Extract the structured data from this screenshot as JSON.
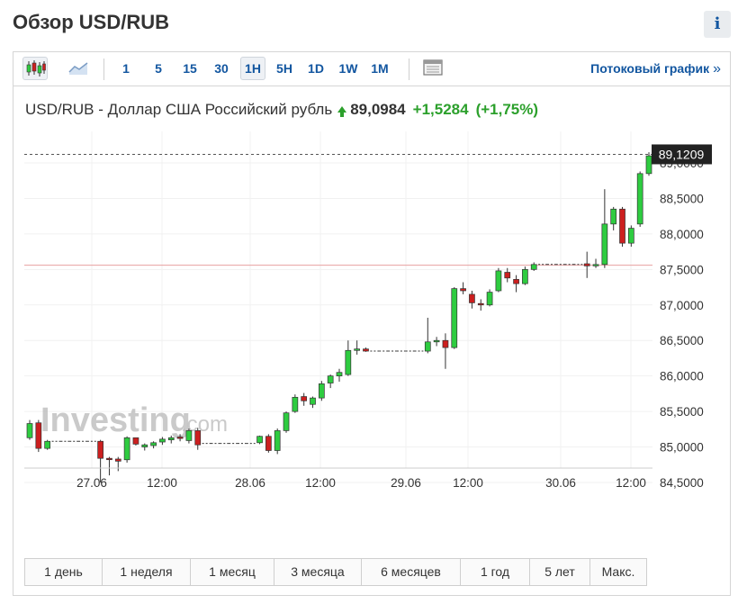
{
  "header": {
    "title": "Обзор USD/RUB",
    "info_label": "i"
  },
  "toolbar": {
    "chart_type_icons": [
      "candlestick-icon",
      "area-chart-icon"
    ],
    "intervals": [
      "1",
      "5",
      "15",
      "30",
      "1H",
      "5H",
      "1D",
      "1W",
      "1M"
    ],
    "active_interval": "1H",
    "table_icon": "table-icon",
    "stream_link": "Потоковый график",
    "stream_chevron": "»"
  },
  "quote": {
    "name": "USD/RUB - Доллар США Российский рубль",
    "price": "89,0984",
    "change": "+1,5284",
    "change_pct": "(+1,75%)"
  },
  "watermark": {
    "brand": "Investing",
    "suffix": ".com"
  },
  "colors": {
    "up": "#2ecc40",
    "down": "#cc1f1f",
    "accent": "#1256a0",
    "change": "#2ca02c",
    "label_bg": "#222222"
  },
  "chart_data": {
    "type": "candlestick",
    "ylim": [
      84.35,
      89.35
    ],
    "y_ticks": [
      "84,5000",
      "85,0000",
      "85,5000",
      "86,0000",
      "86,5000",
      "87,0000",
      "87,5000",
      "88,0000",
      "88,5000",
      "89,0000"
    ],
    "x_ticks": [
      "27.06",
      "12:00",
      "28.06",
      "12:00",
      "29.06",
      "12:00",
      "30.06",
      "12:00"
    ],
    "last_price_label": "89,1209",
    "last_price": 89.1209,
    "reference_line": 87.56,
    "candles": [
      {
        "o": 85.13,
        "h": 85.38,
        "l": 85.1,
        "c": 85.33
      },
      {
        "o": 85.34,
        "h": 85.38,
        "l": 84.93,
        "c": 84.98
      },
      {
        "o": 84.98,
        "h": 85.1,
        "l": 84.96,
        "c": 85.08
      },
      {
        "o": 85.08,
        "h": 85.08,
        "l": 85.08,
        "c": 85.08
      },
      {
        "o": 85.08,
        "h": 85.08,
        "l": 85.08,
        "c": 85.08
      },
      {
        "o": 85.08,
        "h": 85.08,
        "l": 85.08,
        "c": 85.08
      },
      {
        "o": 85.08,
        "h": 85.08,
        "l": 85.08,
        "c": 85.08
      },
      {
        "o": 85.08,
        "h": 85.08,
        "l": 85.08,
        "c": 85.08
      },
      {
        "o": 85.08,
        "h": 85.1,
        "l": 84.5,
        "c": 84.84
      },
      {
        "o": 84.84,
        "h": 84.86,
        "l": 84.6,
        "c": 84.83
      },
      {
        "o": 84.83,
        "h": 84.86,
        "l": 84.66,
        "c": 84.8
      },
      {
        "o": 84.82,
        "h": 85.15,
        "l": 84.78,
        "c": 85.13
      },
      {
        "o": 85.13,
        "h": 85.13,
        "l": 85.02,
        "c": 85.04
      },
      {
        "o": 85.0,
        "h": 85.05,
        "l": 84.95,
        "c": 85.03
      },
      {
        "o": 85.02,
        "h": 85.08,
        "l": 84.98,
        "c": 85.06
      },
      {
        "o": 85.07,
        "h": 85.14,
        "l": 85.03,
        "c": 85.11
      },
      {
        "o": 85.1,
        "h": 85.16,
        "l": 85.05,
        "c": 85.13
      },
      {
        "o": 85.14,
        "h": 85.18,
        "l": 85.08,
        "c": 85.12
      },
      {
        "o": 85.09,
        "h": 85.26,
        "l": 85.05,
        "c": 85.23
      },
      {
        "o": 85.23,
        "h": 85.27,
        "l": 84.96,
        "c": 85.03
      },
      {
        "o": 85.05,
        "h": 85.05,
        "l": 85.05,
        "c": 85.05
      },
      {
        "o": 85.05,
        "h": 85.05,
        "l": 85.05,
        "c": 85.05
      },
      {
        "o": 85.05,
        "h": 85.05,
        "l": 85.05,
        "c": 85.05
      },
      {
        "o": 85.05,
        "h": 85.05,
        "l": 85.05,
        "c": 85.05
      },
      {
        "o": 85.05,
        "h": 85.05,
        "l": 85.05,
        "c": 85.05
      },
      {
        "o": 85.05,
        "h": 85.05,
        "l": 85.05,
        "c": 85.05
      },
      {
        "o": 85.06,
        "h": 85.16,
        "l": 85.04,
        "c": 85.15
      },
      {
        "o": 85.15,
        "h": 85.18,
        "l": 84.92,
        "c": 84.95
      },
      {
        "o": 84.95,
        "h": 85.26,
        "l": 84.9,
        "c": 85.23
      },
      {
        "o": 85.23,
        "h": 85.5,
        "l": 85.2,
        "c": 85.48
      },
      {
        "o": 85.5,
        "h": 85.74,
        "l": 85.48,
        "c": 85.7
      },
      {
        "o": 85.71,
        "h": 85.76,
        "l": 85.58,
        "c": 85.65
      },
      {
        "o": 85.6,
        "h": 85.71,
        "l": 85.55,
        "c": 85.69
      },
      {
        "o": 85.69,
        "h": 85.93,
        "l": 85.65,
        "c": 85.89
      },
      {
        "o": 85.9,
        "h": 86.02,
        "l": 85.83,
        "c": 86.0
      },
      {
        "o": 86.0,
        "h": 86.1,
        "l": 85.92,
        "c": 86.05
      },
      {
        "o": 86.02,
        "h": 86.5,
        "l": 86.0,
        "c": 86.36
      },
      {
        "o": 86.36,
        "h": 86.5,
        "l": 86.3,
        "c": 86.38
      },
      {
        "o": 86.38,
        "h": 86.4,
        "l": 86.34,
        "c": 86.35
      },
      {
        "o": 86.35,
        "h": 86.35,
        "l": 86.35,
        "c": 86.35
      },
      {
        "o": 86.35,
        "h": 86.35,
        "l": 86.35,
        "c": 86.35
      },
      {
        "o": 86.35,
        "h": 86.35,
        "l": 86.35,
        "c": 86.35
      },
      {
        "o": 86.35,
        "h": 86.35,
        "l": 86.35,
        "c": 86.35
      },
      {
        "o": 86.35,
        "h": 86.35,
        "l": 86.35,
        "c": 86.35
      },
      {
        "o": 86.35,
        "h": 86.35,
        "l": 86.35,
        "c": 86.35
      },
      {
        "o": 86.35,
        "h": 86.82,
        "l": 86.32,
        "c": 86.48
      },
      {
        "o": 86.48,
        "h": 86.55,
        "l": 86.42,
        "c": 86.5
      },
      {
        "o": 86.5,
        "h": 86.6,
        "l": 86.1,
        "c": 86.4
      },
      {
        "o": 86.4,
        "h": 87.25,
        "l": 86.38,
        "c": 87.23
      },
      {
        "o": 87.23,
        "h": 87.32,
        "l": 87.15,
        "c": 87.2
      },
      {
        "o": 87.15,
        "h": 87.2,
        "l": 86.95,
        "c": 87.03
      },
      {
        "o": 87.02,
        "h": 87.08,
        "l": 86.92,
        "c": 87.0
      },
      {
        "o": 87.0,
        "h": 87.22,
        "l": 86.98,
        "c": 87.18
      },
      {
        "o": 87.2,
        "h": 87.52,
        "l": 87.18,
        "c": 87.48
      },
      {
        "o": 87.46,
        "h": 87.52,
        "l": 87.32,
        "c": 87.38
      },
      {
        "o": 87.36,
        "h": 87.42,
        "l": 87.18,
        "c": 87.3
      },
      {
        "o": 87.3,
        "h": 87.54,
        "l": 87.28,
        "c": 87.5
      },
      {
        "o": 87.5,
        "h": 87.6,
        "l": 87.48,
        "c": 87.57
      },
      {
        "o": 87.57,
        "h": 87.57,
        "l": 87.57,
        "c": 87.57
      },
      {
        "o": 87.57,
        "h": 87.57,
        "l": 87.57,
        "c": 87.57
      },
      {
        "o": 87.57,
        "h": 87.57,
        "l": 87.57,
        "c": 87.57
      },
      {
        "o": 87.57,
        "h": 87.57,
        "l": 87.57,
        "c": 87.57
      },
      {
        "o": 87.57,
        "h": 87.57,
        "l": 87.57,
        "c": 87.57
      },
      {
        "o": 87.58,
        "h": 87.75,
        "l": 87.38,
        "c": 87.55
      },
      {
        "o": 87.55,
        "h": 87.65,
        "l": 87.52,
        "c": 87.57
      },
      {
        "o": 87.57,
        "h": 88.63,
        "l": 87.52,
        "c": 88.14
      },
      {
        "o": 88.14,
        "h": 88.38,
        "l": 88.05,
        "c": 88.35
      },
      {
        "o": 88.35,
        "h": 88.38,
        "l": 87.82,
        "c": 87.87
      },
      {
        "o": 87.87,
        "h": 88.12,
        "l": 87.82,
        "c": 88.08
      },
      {
        "o": 88.14,
        "h": 88.88,
        "l": 88.1,
        "c": 88.85
      },
      {
        "o": 88.85,
        "h": 89.15,
        "l": 88.82,
        "c": 89.1
      }
    ]
  },
  "ranges": [
    "1 день",
    "1 неделя",
    "1 месяц",
    "3 месяца",
    "6 месяцев",
    "1 год",
    "5 лет",
    "Макс."
  ]
}
